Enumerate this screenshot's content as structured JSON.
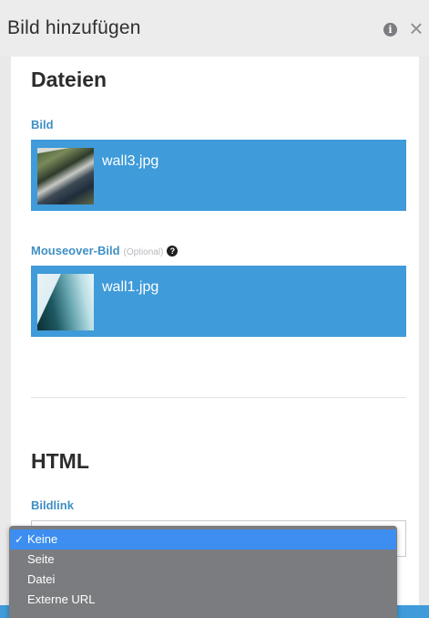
{
  "dialog": {
    "title": "Bild hinzufügen",
    "info_icon": "info-icon",
    "close_icon": "close-icon",
    "close_glyph": "×"
  },
  "files_section": {
    "title": "Dateien",
    "image_label": "Bild",
    "image_file": "wall3.jpg",
    "mouseover_label": "Mouseover-Bild",
    "mouseover_optional": "(Optional)",
    "mouseover_help_glyph": "?",
    "mouseover_file": "wall1.jpg"
  },
  "html_section": {
    "title": "HTML",
    "link_label": "Bildlink",
    "link_options": [
      "Keine",
      "Seite",
      "Datei",
      "Externe URL"
    ],
    "link_selected": "Keine",
    "check_glyph": "✓"
  },
  "colors": {
    "accent": "#3f9bd9",
    "label": "#3f8fc4",
    "dropdown_bg": "#7b7c7f",
    "dropdown_selected": "#3d8ef0"
  }
}
